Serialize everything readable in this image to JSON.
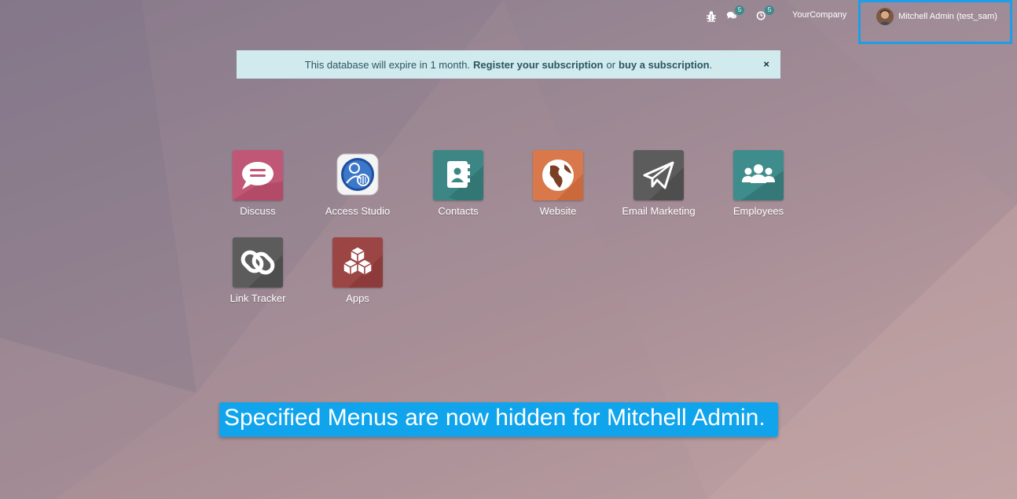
{
  "topbar": {
    "bug_icon": "bug-icon",
    "messages": {
      "icon": "chat-icon",
      "count": "5"
    },
    "activities": {
      "icon": "clock-icon",
      "count": "5"
    },
    "company": "YourCompany",
    "user": {
      "name": "Mitchell Admin (test_sam)",
      "avatar": "user-avatar"
    }
  },
  "alert": {
    "prefix": "This database will expire in 1 month.",
    "link1": "Register your subscription",
    "or": "or",
    "link2": "buy a subscription",
    "suffix": ".",
    "close": "×"
  },
  "apps": [
    {
      "label": "Discuss",
      "icon": "chat-bubble-icon",
      "color": "#b34b6c"
    },
    {
      "label": "Access Studio",
      "icon": "access-studio-icon",
      "color": "#ffffff"
    },
    {
      "label": "Contacts",
      "icon": "address-book-icon",
      "color": "#3c8786"
    },
    {
      "label": "Website",
      "icon": "globe-icon",
      "color": "#d9703c"
    },
    {
      "label": "Email Marketing",
      "icon": "paper-plane-icon",
      "color": "#5b5b5b"
    },
    {
      "label": "Employees",
      "icon": "users-icon",
      "color": "#3c8786"
    },
    {
      "label": "Link Tracker",
      "icon": "link-icon",
      "color": "#5b5b5b"
    },
    {
      "label": "Apps",
      "icon": "cubes-icon",
      "color": "#963e3e"
    }
  ],
  "toast": {
    "text": "Specified Menus are now hidden for Mitchell Admin."
  }
}
